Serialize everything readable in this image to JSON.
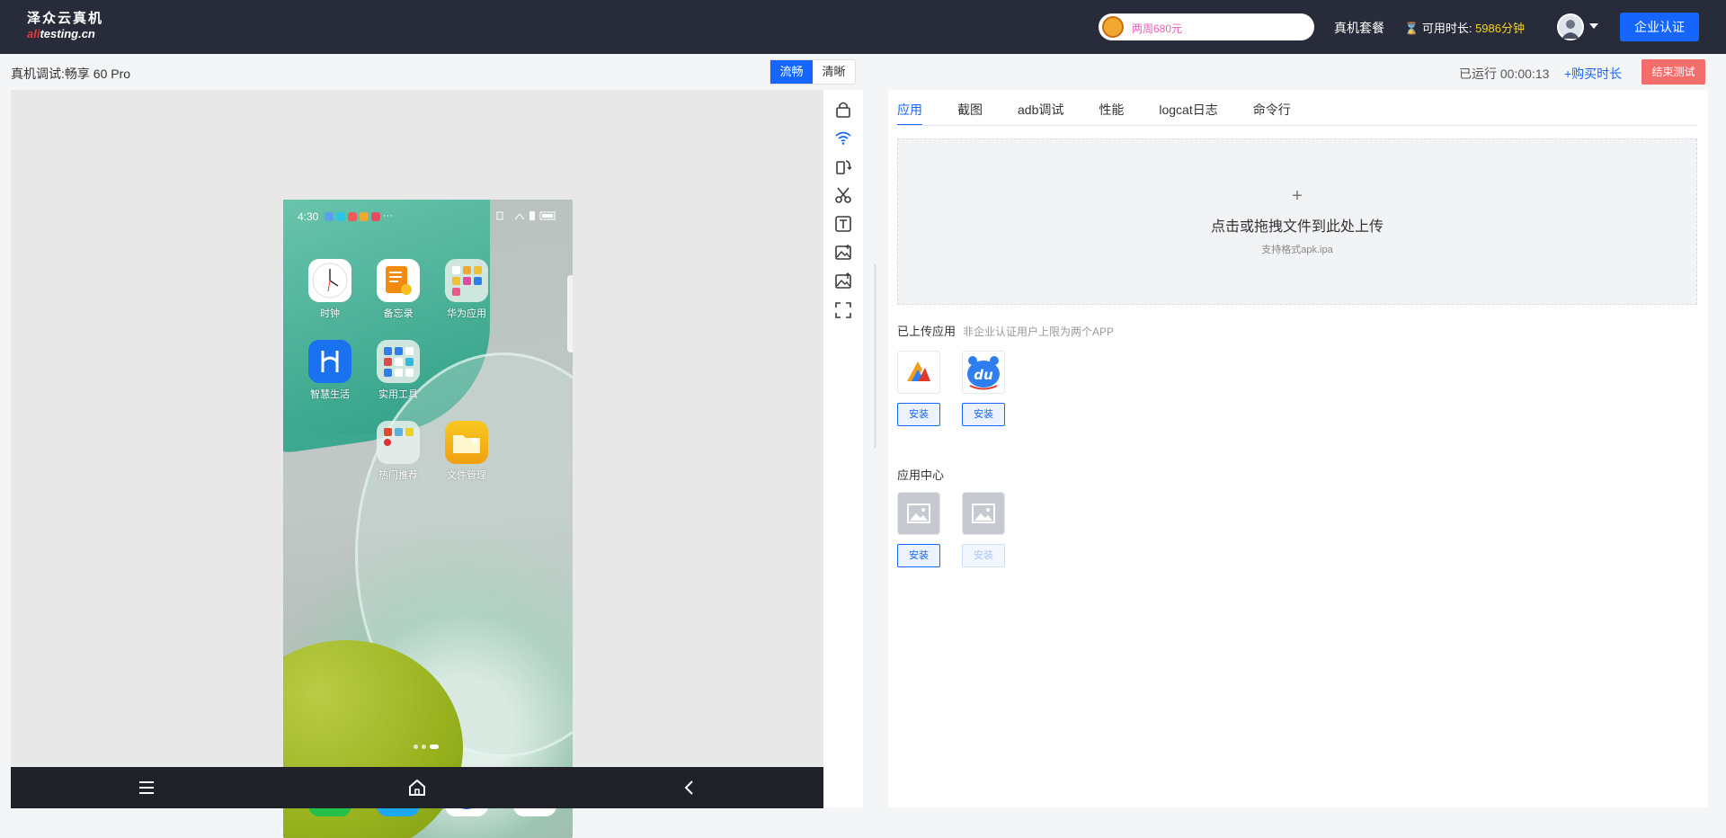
{
  "header": {
    "logo_cn": "泽众云真机",
    "logo_en_red": "ali",
    "logo_en_rest": "testing.cn",
    "promo_text": "两周680元",
    "plan_link": "真机套餐",
    "available_label": "可用时长:",
    "available_value": "5986分钟",
    "cert_button": "企业认证"
  },
  "subbar": {
    "device_title": "真机调试:畅享 60 Pro",
    "quality_options": [
      "流畅",
      "清晰"
    ],
    "quality_selected": "流畅",
    "runtime": "已运行 00:00:13",
    "buy_link": "+购买时长",
    "end_button": "结束测试"
  },
  "phone": {
    "time": "4:30",
    "more": "···",
    "apps": [
      {
        "label": "时钟",
        "icon": "clock-icon"
      },
      {
        "label": "备忘录",
        "icon": "notes-icon"
      },
      {
        "label": "华为应用",
        "icon": "folder-icon"
      },
      {
        "label": "智慧生活",
        "icon": "smart-life-icon"
      },
      {
        "label": "实用工具",
        "icon": "folder-icon"
      },
      {
        "label": "热门推荐",
        "icon": "folder-icon"
      },
      {
        "label": "文件管理",
        "icon": "files-icon"
      }
    ],
    "dock": [
      {
        "icon": "phone-icon"
      },
      {
        "icon": "messages-icon"
      },
      {
        "icon": "browser-icon"
      },
      {
        "icon": "camera-icon"
      }
    ]
  },
  "navbar": {
    "menu": "menu-icon",
    "home": "home-icon",
    "back": "back-icon"
  },
  "toolbar": [
    "lock-icon",
    "wifi-icon",
    "rotate-icon",
    "cut-icon",
    "text-icon",
    "image-icon",
    "image-upload-icon",
    "fullscreen-icon"
  ],
  "panel": {
    "tabs": [
      "应用",
      "截图",
      "adb调试",
      "性能",
      "logcat日志",
      "命令行"
    ],
    "active_tab": "应用",
    "upload": {
      "plus": "+",
      "title": "点击或拖拽文件到此处上传",
      "subtitle": "支持格式apk.ipa"
    },
    "uploaded": {
      "title": "已上传应用",
      "note": "非企业认证用户上限为两个APP",
      "install_label": "安装"
    },
    "center": {
      "title": "应用中心",
      "install_label": "安装"
    }
  },
  "colors": {
    "accent": "#1765ff",
    "header_bg": "#282c3a",
    "danger": "#f56c6c",
    "highlight": "#f7d51b",
    "promo": "#ea5fb5"
  }
}
